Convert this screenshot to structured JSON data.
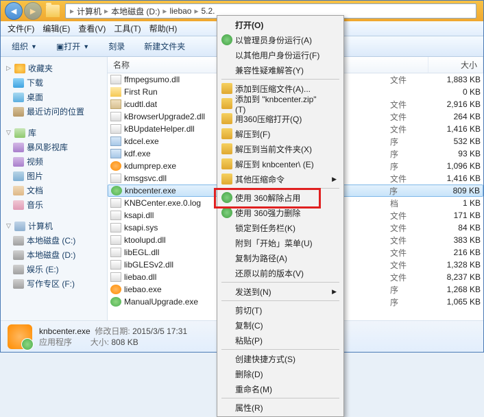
{
  "breadcrumb": [
    "计算机",
    "本地磁盘 (D:)",
    "liebao",
    "5.2."
  ],
  "menus": [
    "文件(F)",
    "编辑(E)",
    "查看(V)",
    "工具(T)",
    "帮助(H)"
  ],
  "toolbar": {
    "organize": "组织",
    "open": "打开",
    "burn": "刻录",
    "newfolder": "新建文件夹"
  },
  "sidebar": {
    "fav": {
      "head": "收藏夹",
      "items": [
        "下载",
        "桌面",
        "最近访问的位置"
      ]
    },
    "lib": {
      "head": "库",
      "items": [
        "暴风影视库",
        "视频",
        "图片",
        "文档",
        "音乐"
      ]
    },
    "comp": {
      "head": "计算机",
      "items": [
        "本地磁盘 (C:)",
        "本地磁盘 (D:)",
        "娱乐 (E:)",
        "写作专区 (F:)"
      ]
    }
  },
  "columns": {
    "name": "名称",
    "size": "大小"
  },
  "files": [
    {
      "n": "ffmpegsumo.dll",
      "ic": "dll",
      "t": "文件",
      "s": "1,883 KB"
    },
    {
      "n": "First Run",
      "ic": "fold",
      "t": "",
      "s": "0 KB"
    },
    {
      "n": "icudtl.dat",
      "ic": "dat",
      "t": "文件",
      "s": "2,916 KB"
    },
    {
      "n": "kBrowserUpgrade2.dll",
      "ic": "dll",
      "t": "文件",
      "s": "264 KB"
    },
    {
      "n": "kBUpdateHelper.dll",
      "ic": "dll",
      "t": "文件",
      "s": "1,416 KB"
    },
    {
      "n": "kdcel.exe",
      "ic": "exe",
      "t": "序",
      "s": "532 KB"
    },
    {
      "n": "kdf.exe",
      "ic": "exe",
      "t": "序",
      "s": "93 KB"
    },
    {
      "n": "kdumprep.exe",
      "ic": "orange",
      "t": "序",
      "s": "1,096 KB"
    },
    {
      "n": "kmsgsvc.dll",
      "ic": "dll",
      "t": "文件",
      "s": "1,416 KB"
    },
    {
      "n": "knbcenter.exe",
      "ic": "shield",
      "t": "序",
      "s": "809 KB",
      "sel": true
    },
    {
      "n": "KNBCenter.exe.0.log",
      "ic": "dll",
      "t": "档",
      "s": "1 KB"
    },
    {
      "n": "ksapi.dll",
      "ic": "dll",
      "t": "文件",
      "s": "171 KB"
    },
    {
      "n": "ksapi.sys",
      "ic": "dll",
      "t": "文件",
      "s": "84 KB"
    },
    {
      "n": "ktoolupd.dll",
      "ic": "dll",
      "t": "文件",
      "s": "383 KB"
    },
    {
      "n": "libEGL.dll",
      "ic": "dll",
      "t": "文件",
      "s": "216 KB"
    },
    {
      "n": "libGLESv2.dll",
      "ic": "dll",
      "t": "文件",
      "s": "1,328 KB"
    },
    {
      "n": "liebao.dll",
      "ic": "dll",
      "t": "文件",
      "s": "8,237 KB"
    },
    {
      "n": "liebao.exe",
      "ic": "orange",
      "t": "序",
      "s": "1,268 KB"
    },
    {
      "n": "ManualUpgrade.exe",
      "ic": "shield",
      "t": "序",
      "s": "1,065 KB"
    }
  ],
  "ctx": [
    {
      "l": "打开(O)",
      "bold": true
    },
    {
      "l": "以管理员身份运行(A)",
      "ic": "sec"
    },
    {
      "l": "以其他用户身份运行(F)"
    },
    {
      "l": "兼容性疑难解答(Y)"
    },
    {
      "sep": true
    },
    {
      "l": "添加到压缩文件(A)...",
      "ic": "zip"
    },
    {
      "l": "添加到 \"knbcenter.zip\" (T)",
      "ic": "zip"
    },
    {
      "l": "用360压缩打开(Q)",
      "ic": "zip"
    },
    {
      "l": "解压到(F)",
      "ic": "zip"
    },
    {
      "l": "解压到当前文件夹(X)",
      "ic": "zip"
    },
    {
      "l": "解压到 knbcenter\\ (E)",
      "ic": "zip"
    },
    {
      "l": "其他压缩命令",
      "ic": "zip",
      "sub": true
    },
    {
      "sep": true
    },
    {
      "l": "使用 360解除占用",
      "ic": "sec"
    },
    {
      "l": "使用 360强力删除",
      "ic": "sec"
    },
    {
      "l": "锁定到任务栏(K)"
    },
    {
      "l": "附到「开始」菜单(U)"
    },
    {
      "l": "复制为路径(A)"
    },
    {
      "l": "还原以前的版本(V)"
    },
    {
      "sep": true
    },
    {
      "l": "发送到(N)",
      "sub": true
    },
    {
      "sep": true
    },
    {
      "l": "剪切(T)"
    },
    {
      "l": "复制(C)"
    },
    {
      "l": "粘贴(P)"
    },
    {
      "sep": true
    },
    {
      "l": "创建快捷方式(S)"
    },
    {
      "l": "删除(D)"
    },
    {
      "l": "重命名(M)"
    },
    {
      "sep": true
    },
    {
      "l": "属性(R)"
    }
  ],
  "status": {
    "name": "knbcenter.exe",
    "type": "应用程序",
    "modlabel": "修改日期:",
    "mod": "2015/3/5 17:31",
    "sizelabel": "大小:",
    "size": "808 KB"
  }
}
